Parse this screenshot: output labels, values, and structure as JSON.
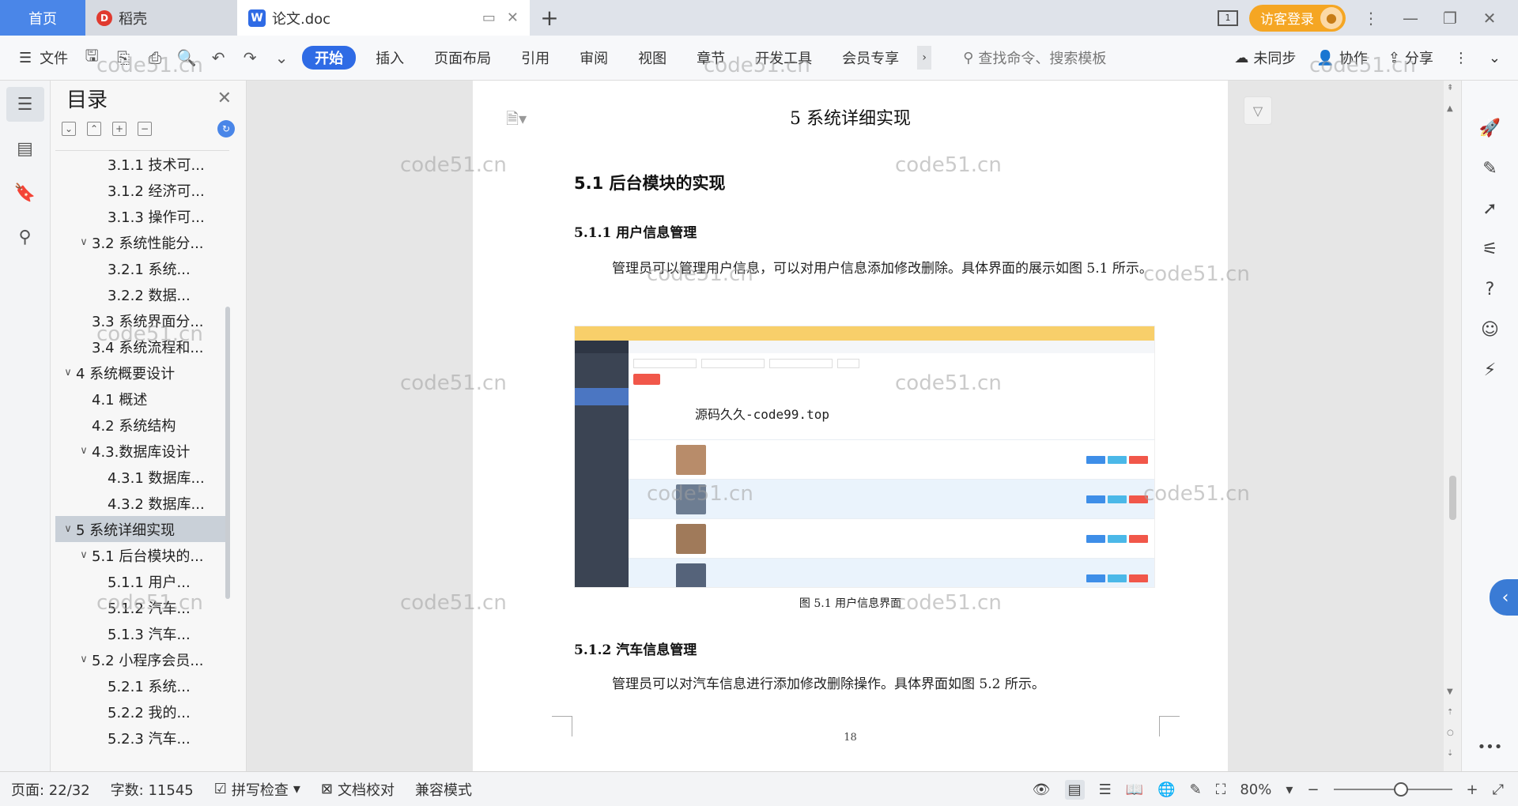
{
  "tabs": {
    "home": "首页",
    "daoke": "稻壳",
    "doc": "论文.doc",
    "new_tab": "+"
  },
  "titlebar": {
    "window_count": "1",
    "login": "访客登录"
  },
  "toolbar": {
    "file": "文件",
    "ribbon_tabs": [
      "开始",
      "插入",
      "页面布局",
      "引用",
      "审阅",
      "视图",
      "章节",
      "开发工具",
      "会员专享"
    ],
    "search_placeholder": "查找命令、搜索模板",
    "sync": "未同步",
    "collab": "协作",
    "share": "分享"
  },
  "outline": {
    "title": "目录",
    "items": [
      {
        "label": "3.1.1 技术可...",
        "level": 3,
        "chev": ""
      },
      {
        "label": "3.1.2 经济可...",
        "level": 3,
        "chev": ""
      },
      {
        "label": "3.1.3 操作可...",
        "level": 3,
        "chev": ""
      },
      {
        "label": "3.2 系统性能分...",
        "level": 2,
        "chev": "∨"
      },
      {
        "label": "3.2.1  系统...",
        "level": 3,
        "chev": ""
      },
      {
        "label": "3.2.2  数据...",
        "level": 3,
        "chev": ""
      },
      {
        "label": "3.3 系统界面分...",
        "level": 2,
        "chev": ""
      },
      {
        "label": "3.4 系统流程和...",
        "level": 2,
        "chev": ""
      },
      {
        "label": "4 系统概要设计",
        "level": 1,
        "chev": "∨"
      },
      {
        "label": "4.1 概述",
        "level": 2,
        "chev": ""
      },
      {
        "label": "4.2 系统结构",
        "level": 2,
        "chev": ""
      },
      {
        "label": "4.3.数据库设计",
        "level": 2,
        "chev": "∨"
      },
      {
        "label": "4.3.1 数据库...",
        "level": 3,
        "chev": ""
      },
      {
        "label": "4.3.2 数据库...",
        "level": 3,
        "chev": ""
      },
      {
        "label": "5 系统详细实现",
        "level": 1,
        "chev": "∨",
        "selected": true
      },
      {
        "label": "5.1  后台模块的...",
        "level": 2,
        "chev": "∨"
      },
      {
        "label": "5.1.1  用户...",
        "level": 3,
        "chev": ""
      },
      {
        "label": "5.1.2  汽车...",
        "level": 3,
        "chev": ""
      },
      {
        "label": "5.1.3  汽车...",
        "level": 3,
        "chev": ""
      },
      {
        "label": "5.2  小程序会员...",
        "level": 2,
        "chev": "∨"
      },
      {
        "label": "5.2.1  系统...",
        "level": 3,
        "chev": ""
      },
      {
        "label": "5.2.2  我的...",
        "level": 3,
        "chev": ""
      },
      {
        "label": "5.2.3  汽车...",
        "level": 3,
        "chev": ""
      }
    ]
  },
  "document": {
    "chapter": "5 系统详细实现",
    "section": "5.1  后台模块的实现",
    "sub1": "5.1.1  用户信息管理",
    "para1": "管理员可以管理用户信息，可以对用户信息添加修改删除。具体界面的展示如图 5.1 所示。",
    "figure_caption": "图 5.1  用户信息界面",
    "figure_watermark": "源码久久-code99.top",
    "sub2": "5.1.2  汽车信息管理",
    "para2": "管理员可以对汽车信息进行添加修改删除操作。具体界面如图 5.2 所示。",
    "page_number": "18"
  },
  "watermark_text": "code51.cn",
  "statusbar": {
    "page": "页面: 22/32",
    "words": "字数: 11545",
    "spellcheck": "拼写检查",
    "proofread": "文档校对",
    "compat": "兼容模式",
    "zoom": "80%"
  },
  "colors": {
    "accent": "#2f6be5",
    "home_tab": "#4a86e8",
    "login": "#f5a623"
  }
}
